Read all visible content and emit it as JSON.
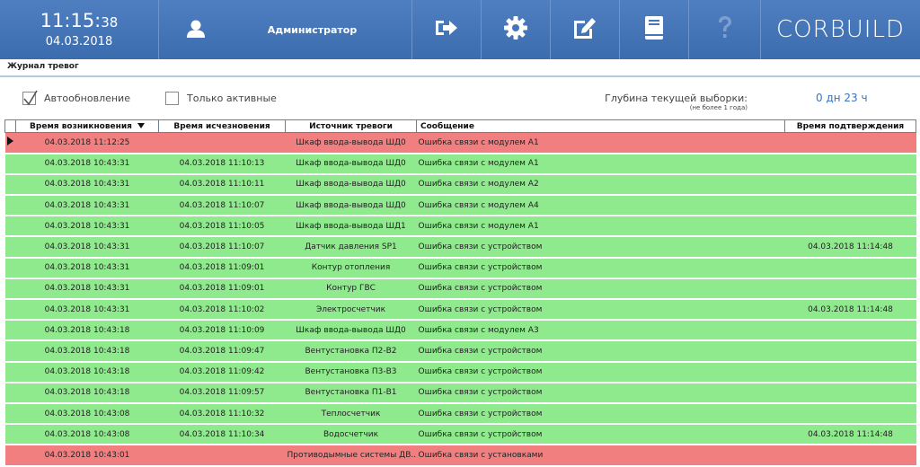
{
  "header": {
    "time_hm": "11:15:",
    "time_sec": "38",
    "date": "04.03.2018",
    "user_name": "Администратор",
    "logo": "CORBUILD",
    "icons": [
      "user-icon",
      "logout-icon",
      "gear-icon",
      "edit-icon",
      "journal-icon",
      "help-icon"
    ],
    "accent_color": "#3b6cae"
  },
  "page": {
    "title": "Журнал тревог"
  },
  "filters": {
    "auto_refresh_label": "Автообновление",
    "auto_refresh_checked": true,
    "only_active_label": "Только активные",
    "only_active_checked": false,
    "depth_label": "Глубина текущей выборки:",
    "depth_sub": "(не более 1 года)",
    "depth_value": "0 дн 23 ч"
  },
  "table": {
    "columns": [
      "",
      "Время возникновения",
      "Время исчезновения",
      "Источник тревоги",
      "Сообщение",
      "Время подтверждения"
    ],
    "row_colors": {
      "active": "#f17f80",
      "cleared": "#8fe98d"
    },
    "rows": [
      {
        "status": "red",
        "selected": true,
        "start": "04.03.2018 11:12:25",
        "end": "",
        "source": "Шкаф ввода-вывода ШД0",
        "message": "Ошибка связи с модулем А1",
        "ack": ""
      },
      {
        "status": "green",
        "selected": false,
        "start": "04.03.2018 10:43:31",
        "end": "04.03.2018 11:10:13",
        "source": "Шкаф ввода-вывода ШД0",
        "message": "Ошибка связи с модулем А1",
        "ack": ""
      },
      {
        "status": "green",
        "selected": false,
        "start": "04.03.2018 10:43:31",
        "end": "04.03.2018 11:10:11",
        "source": "Шкаф ввода-вывода ШД0",
        "message": "Ошибка связи с модулем А2",
        "ack": ""
      },
      {
        "status": "green",
        "selected": false,
        "start": "04.03.2018 10:43:31",
        "end": "04.03.2018 11:10:07",
        "source": "Шкаф ввода-вывода ШД0",
        "message": "Ошибка связи с модулем А4",
        "ack": ""
      },
      {
        "status": "green",
        "selected": false,
        "start": "04.03.2018 10:43:31",
        "end": "04.03.2018 11:10:05",
        "source": "Шкаф ввода-вывода ШД1",
        "message": "Ошибка связи с модулем А1",
        "ack": ""
      },
      {
        "status": "green",
        "selected": false,
        "start": "04.03.2018 10:43:31",
        "end": "04.03.2018 11:10:07",
        "source": "Датчик давления SP1",
        "message": "Ошибка связи с устройством",
        "ack": "04.03.2018 11:14:48"
      },
      {
        "status": "green",
        "selected": false,
        "start": "04.03.2018 10:43:31",
        "end": "04.03.2018 11:09:01",
        "source": "Контур отопления",
        "message": "Ошибка связи с устройством",
        "ack": ""
      },
      {
        "status": "green",
        "selected": false,
        "start": "04.03.2018 10:43:31",
        "end": "04.03.2018 11:09:01",
        "source": "Контур ГВС",
        "message": "Ошибка связи с устройством",
        "ack": ""
      },
      {
        "status": "green",
        "selected": false,
        "start": "04.03.2018 10:43:31",
        "end": "04.03.2018 11:10:02",
        "source": "Электросчетчик",
        "message": "Ошибка связи с устройством",
        "ack": "04.03.2018 11:14:48"
      },
      {
        "status": "green",
        "selected": false,
        "start": "04.03.2018 10:43:18",
        "end": "04.03.2018 11:10:09",
        "source": "Шкаф ввода-вывода ШД0",
        "message": "Ошибка связи с модулем А3",
        "ack": ""
      },
      {
        "status": "green",
        "selected": false,
        "start": "04.03.2018 10:43:18",
        "end": "04.03.2018 11:09:47",
        "source": "Вентустановка П2-В2",
        "message": "Ошибка связи с устройством",
        "ack": ""
      },
      {
        "status": "green",
        "selected": false,
        "start": "04.03.2018 10:43:18",
        "end": "04.03.2018 11:09:42",
        "source": "Вентустановка П3-В3",
        "message": "Ошибка связи с устройством",
        "ack": ""
      },
      {
        "status": "green",
        "selected": false,
        "start": "04.03.2018 10:43:18",
        "end": "04.03.2018 11:09:57",
        "source": "Вентустановка П1-В1",
        "message": "Ошибка связи с устройством",
        "ack": ""
      },
      {
        "status": "green",
        "selected": false,
        "start": "04.03.2018 10:43:08",
        "end": "04.03.2018 11:10:32",
        "source": "Теплосчетчик",
        "message": "Ошибка связи с устройством",
        "ack": ""
      },
      {
        "status": "green",
        "selected": false,
        "start": "04.03.2018 10:43:08",
        "end": "04.03.2018 11:10:34",
        "source": "Водосчетчик",
        "message": "Ошибка связи с устройством",
        "ack": "04.03.2018 11:14:48"
      },
      {
        "status": "red",
        "selected": false,
        "start": "04.03.2018 10:43:01",
        "end": "",
        "source": "Противодымные системы ДВ...",
        "message": "Ошибка связи с установками",
        "ack": ""
      }
    ]
  }
}
